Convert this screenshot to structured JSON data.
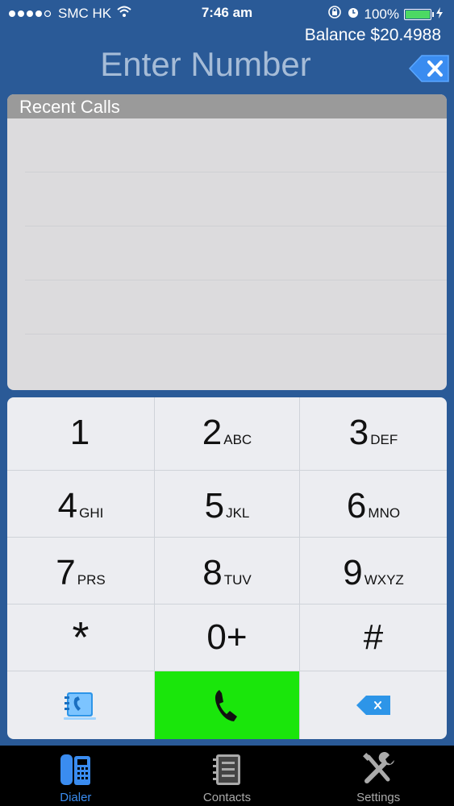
{
  "status_bar": {
    "carrier": "SMC HK",
    "time": "7:46 am",
    "battery": "100%"
  },
  "balance": "Balance $20.4988",
  "number_display": {
    "placeholder": "Enter Number"
  },
  "recent_calls": {
    "title": "Recent Calls"
  },
  "keypad": {
    "keys": [
      {
        "digit": "1",
        "letters": ""
      },
      {
        "digit": "2",
        "letters": "ABC"
      },
      {
        "digit": "3",
        "letters": "DEF"
      },
      {
        "digit": "4",
        "letters": "GHI"
      },
      {
        "digit": "5",
        "letters": "JKL"
      },
      {
        "digit": "6",
        "letters": "MNO"
      },
      {
        "digit": "7",
        "letters": "PRS"
      },
      {
        "digit": "8",
        "letters": "TUV"
      },
      {
        "digit": "9",
        "letters": "WXYZ"
      },
      {
        "digit": "*",
        "letters": ""
      },
      {
        "digit": "0+",
        "letters": ""
      },
      {
        "digit": "#",
        "letters": ""
      }
    ]
  },
  "tabs": [
    {
      "label": "Dialer",
      "icon": "dialer-icon",
      "active": true
    },
    {
      "label": "Contacts",
      "icon": "contacts-icon",
      "active": false
    },
    {
      "label": "Settings",
      "icon": "settings-icon",
      "active": false
    }
  ],
  "colors": {
    "background": "#2a5a97",
    "call_button": "#1ae60b",
    "accent_blue": "#3a8cf0"
  }
}
